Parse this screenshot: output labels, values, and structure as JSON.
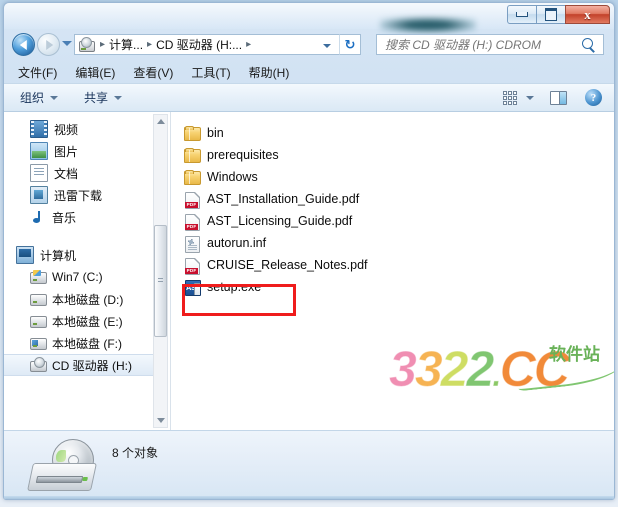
{
  "window": {
    "titlebar": {
      "redacted_label": "",
      "minimize": "–",
      "maximize": "□",
      "close": "x"
    }
  },
  "navigation": {
    "back_label": "后退",
    "forward_label": "前进",
    "recent_dropdown": "最近浏览的位置",
    "breadcrumb": {
      "items": [
        "计算...",
        "CD 驱动器 (H:..."
      ],
      "separator": "▸",
      "dropdown": "▾"
    },
    "refresh_label": "↻",
    "search": {
      "placeholder": "搜索 CD 驱动器 (H:) CDROM",
      "value": ""
    }
  },
  "menubar": {
    "items": [
      {
        "label": "文件(F)"
      },
      {
        "label": "编辑(E)"
      },
      {
        "label": "查看(V)"
      },
      {
        "label": "工具(T)"
      },
      {
        "label": "帮助(H)"
      }
    ]
  },
  "toolbar": {
    "organize_label": "组织",
    "share_label": "共享",
    "help_label": "?"
  },
  "sidebar": {
    "library_items": [
      {
        "label": "视频",
        "icon": "video-icon"
      },
      {
        "label": "图片",
        "icon": "pictures-icon"
      },
      {
        "label": "文档",
        "icon": "documents-icon"
      },
      {
        "label": "迅雷下载",
        "icon": "download-icon"
      },
      {
        "label": "音乐",
        "icon": "music-icon"
      }
    ],
    "computer_group": {
      "label": "计算机",
      "icon": "computer-icon"
    },
    "drives": [
      {
        "label": "Win7 (C:)",
        "icon": "system-drive-icon",
        "selected": false
      },
      {
        "label": "本地磁盘 (D:)",
        "icon": "hard-drive-icon",
        "selected": false
      },
      {
        "label": "本地磁盘 (E:)",
        "icon": "hard-drive-icon",
        "selected": false
      },
      {
        "label": "本地磁盘 (F:)",
        "icon": "hard-drive-icon",
        "selected": false
      },
      {
        "label": "CD 驱动器 (H:)",
        "icon": "cd-drive-icon",
        "selected": true
      }
    ]
  },
  "files": {
    "items": [
      {
        "name": "bin",
        "type": "folder"
      },
      {
        "name": "prerequisites",
        "type": "folder"
      },
      {
        "name": "Windows",
        "type": "folder"
      },
      {
        "name": "AST_Installation_Guide.pdf",
        "type": "pdf"
      },
      {
        "name": "AST_Licensing_Guide.pdf",
        "type": "pdf"
      },
      {
        "name": "autorun.inf",
        "type": "inf"
      },
      {
        "name": "CRUISE_Release_Notes.pdf",
        "type": "pdf"
      },
      {
        "name": "setup.exe",
        "type": "exe",
        "highlighted": true
      }
    ],
    "exe_icon_text": "AST"
  },
  "watermark": {
    "d1": "3",
    "d2": "3",
    "d3": "2",
    "d4": "2",
    "dot": ".",
    "cc": "CC",
    "site": "软件站"
  },
  "status": {
    "item_count_label": "8 个对象"
  },
  "colors": {
    "accent": "#1b6ec2",
    "highlight_box": "#ef1c1c",
    "close_button": "#c2412a",
    "folder": "#e9b949",
    "pdf": "#c8102e"
  }
}
